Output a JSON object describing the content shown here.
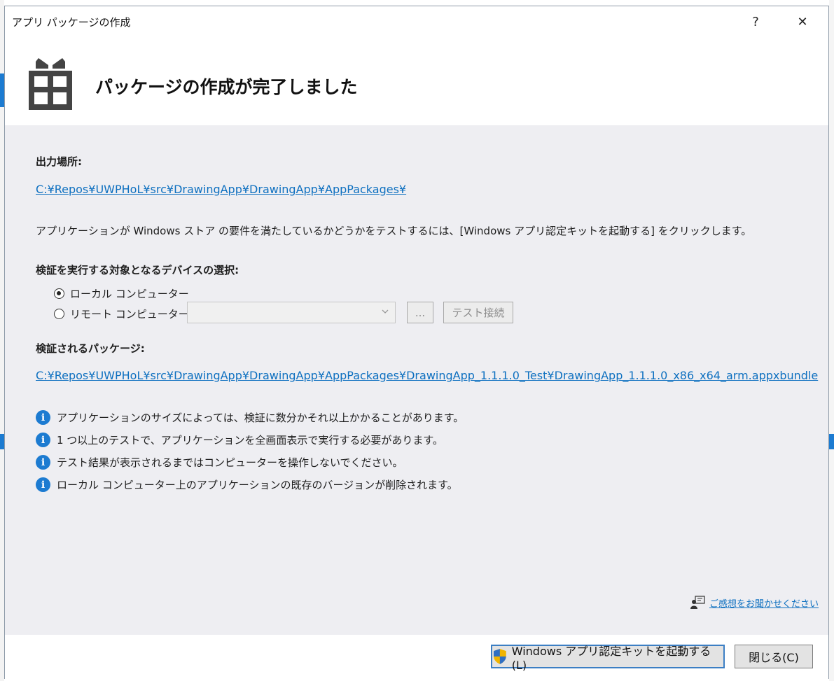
{
  "window": {
    "title": "アプリ パッケージの作成",
    "help_glyph": "?",
    "close_glyph": "✕"
  },
  "header": {
    "title": "パッケージの作成が完了しました",
    "icon": "gift-icon"
  },
  "output": {
    "label": "出力場所:",
    "path": "C:¥Repos¥UWPHoL¥src¥DrawingApp¥DrawingApp¥AppPackages¥"
  },
  "description": "アプリケーションが Windows ストア の要件を満たしているかどうかをテストするには、[Windows アプリ認定キットを起動する] をクリックします。",
  "device": {
    "label": "検証を実行する対象となるデバイスの選択:",
    "local_label": "ローカル コンピューター",
    "remote_label": "リモート コンピューター:",
    "selected": "local",
    "remote_value": "",
    "browse_label": "...",
    "test_connect_label": "テスト接続"
  },
  "package": {
    "label": "検証されるパッケージ:",
    "path": "C:¥Repos¥UWPHoL¥src¥DrawingApp¥DrawingApp¥AppPackages¥DrawingApp_1.1.1.0_Test¥DrawingApp_1.1.1.0_x86_x64_arm.appxbundle"
  },
  "notes": [
    "アプリケーションのサイズによっては、検証に数分かそれ以上かかることがあります。",
    "1 つ以上のテストで、アプリケーションを全画面表示で実行する必要があります。",
    "テスト結果が表示されるまではコンピューターを操作しないでください。",
    "ローカル コンピューター上のアプリケーションの既存のバージョンが削除されます。"
  ],
  "feedback": {
    "label": "ご感想をお聞かせください",
    "icon": "feedback-person-icon"
  },
  "footer": {
    "launch_label": "Windows アプリ認定キットを起動する(L)",
    "close_label": "閉じる(C)"
  },
  "colors": {
    "accent": "#1c7bd1",
    "link": "#0e70c0",
    "dialog_bg": "#eeeef2"
  }
}
